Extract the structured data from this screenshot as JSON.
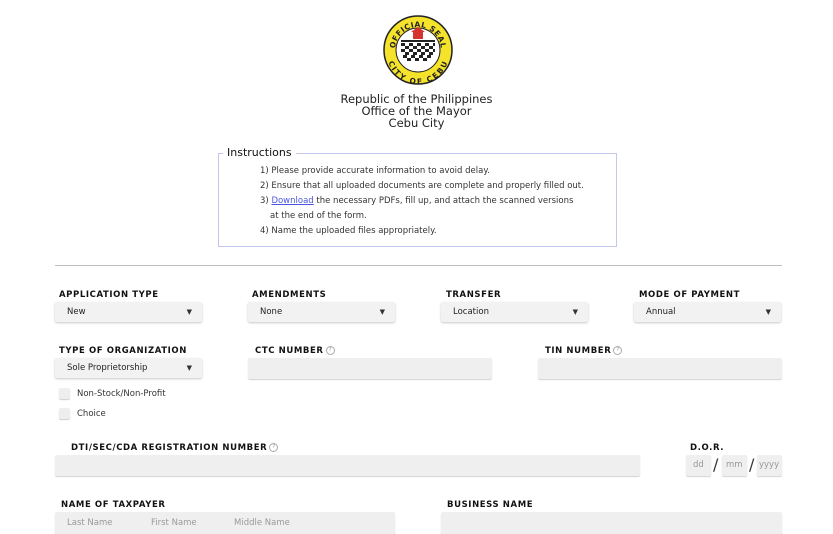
{
  "seal": {
    "top_text": "OFFICIAL SEAL",
    "bottom_text": "CITY OF CEBU"
  },
  "header": {
    "line1": "Republic of the Philippines",
    "line2": "Office of the Mayor",
    "line3": "Cebu City"
  },
  "instructions": {
    "title": "Instructions",
    "item1": "1) Please provide accurate information to avoid delay.",
    "item2": "2) Ensure that all uploaded documents are complete and properly filled out.",
    "item3_prefix": "3) ",
    "item3_link": "Download",
    "item3_suffix": " the necessary PDFs, fill up, and attach the scanned versions",
    "item3_cont": "at the end of the form.",
    "item4": "4) Name the uploaded files appropriately."
  },
  "form": {
    "application_type": {
      "label": "APPLICATION TYPE",
      "value": "New"
    },
    "amendments": {
      "label": "AMENDMENTS",
      "value": "None"
    },
    "transfer": {
      "label": "TRANSFER",
      "value": "Location"
    },
    "mode_of_payment": {
      "label": "MODE OF PAYMENT",
      "value": "Annual"
    },
    "type_of_organization": {
      "label": "TYPE OF ORGANIZATION",
      "value": "Sole Proprietorship"
    },
    "ctc_number": {
      "label": "CTC NUMBER",
      "help": "?"
    },
    "tin_number": {
      "label": "TIN NUMBER",
      "help": "?"
    },
    "non_stock": {
      "label": "Non-Stock/Non-Profit"
    },
    "choice": {
      "label": "Choice"
    },
    "registration_number": {
      "label": "DTI/SEC/CDA REGISTRATION NUMBER",
      "help": "?"
    },
    "dor": {
      "label": "D.O.R.",
      "dd": "dd",
      "mm": "mm",
      "yyyy": "yyyy",
      "sep": "/"
    },
    "taxpayer": {
      "label": "NAME OF TAXPAYER",
      "last_placeholder": "Last Name",
      "first_placeholder": "First Name",
      "middle_placeholder": "Middle Name"
    },
    "business_name": {
      "label": "BUSINESS NAME"
    }
  },
  "colors": {
    "instructions_border": "#c4c6ee",
    "link": "#4a55e0",
    "seal_yellow": "#f5e22a",
    "seal_red": "#d6322e"
  }
}
